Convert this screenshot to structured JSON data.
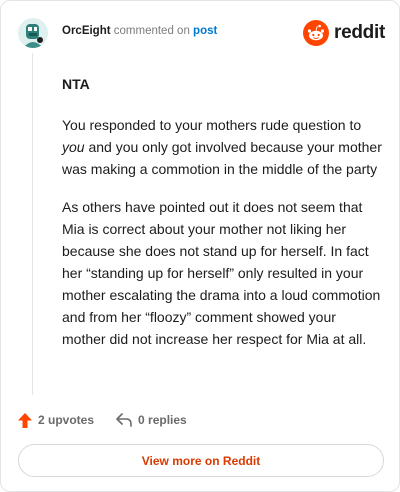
{
  "header": {
    "author": "OrcEight",
    "verb": "commented on",
    "post_link": "post",
    "brand": "reddit"
  },
  "comment": {
    "title": "NTA",
    "p1_before": "You responded to your mothers rude question to ",
    "p1_em": "you",
    "p1_after": " and you only got involved because your mother was making a commotion in the middle of the party",
    "p2": "As others have pointed out it does not seem that Mia is correct about your mother not liking her because she does not stand up for herself. In fact her “standing up for herself” only resulted in your mother escalating the drama into a loud commotion and from her “floozy” comment showed your mother did not increase her respect for Mia at all."
  },
  "actions": {
    "upvotes": "2 upvotes",
    "replies": "0 replies"
  },
  "footer": {
    "button": "View more on Reddit"
  },
  "icons": {
    "avatar": "avatar-icon",
    "brand": "reddit-snoo-icon",
    "upvote": "upvote-arrow-icon",
    "reply": "reply-arrow-icon"
  },
  "colors": {
    "accent": "#ff4500",
    "link": "#0079d3",
    "button_text": "#d93a00"
  }
}
